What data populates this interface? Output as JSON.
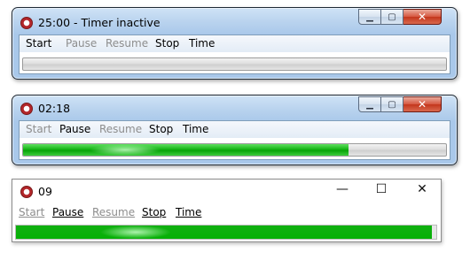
{
  "icons": {
    "app": "timer-app-icon",
    "minimize": "minimize-icon",
    "maximize": "maximize-icon",
    "close": "close-icon"
  },
  "colors": {
    "progress_green": "#0fb10f",
    "close_red": "#c3361c",
    "disabled_text": "#8d8d8d"
  },
  "windows": [
    {
      "style": "windows-7",
      "title": "25:00 - Timer inactive",
      "menu": [
        {
          "label": "Start",
          "enabled": true
        },
        {
          "label": "Pause",
          "enabled": false
        },
        {
          "label": "Resume",
          "enabled": false
        },
        {
          "label": "Stop",
          "enabled": true
        },
        {
          "label": "Time",
          "enabled": true
        }
      ],
      "progress": 0.0
    },
    {
      "style": "windows-7",
      "title": "02:18",
      "menu": [
        {
          "label": "Start",
          "enabled": false
        },
        {
          "label": "Pause",
          "enabled": true
        },
        {
          "label": "Resume",
          "enabled": false
        },
        {
          "label": "Stop",
          "enabled": true
        },
        {
          "label": "Time",
          "enabled": true
        }
      ],
      "progress": 0.77
    },
    {
      "style": "windows-10",
      "title": "09",
      "menu": [
        {
          "label": "Start",
          "enabled": false
        },
        {
          "label": "Pause",
          "enabled": true
        },
        {
          "label": "Resume",
          "enabled": false
        },
        {
          "label": "Stop",
          "enabled": true
        },
        {
          "label": "Time",
          "enabled": true
        }
      ],
      "caption_glyphs": {
        "minimize": "—",
        "maximize": "☐",
        "close": "✕"
      },
      "progress": 0.99
    }
  ]
}
